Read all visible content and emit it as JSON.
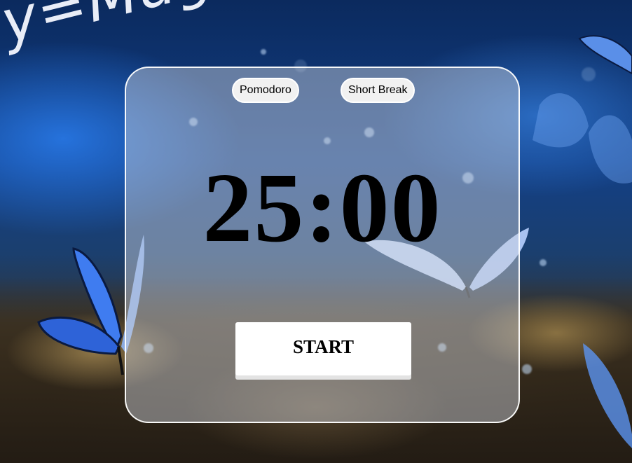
{
  "background": {
    "handwriting": "y=Magic",
    "description_icon": "butterfly-icon"
  },
  "timer": {
    "modes": [
      {
        "label": "Pomodoro"
      },
      {
        "label": "Short Break"
      }
    ],
    "time": "25:00",
    "start_label": "START"
  },
  "colors": {
    "card_border": "#ffffff",
    "button_bg": "#ffffff",
    "text": "#000000"
  }
}
